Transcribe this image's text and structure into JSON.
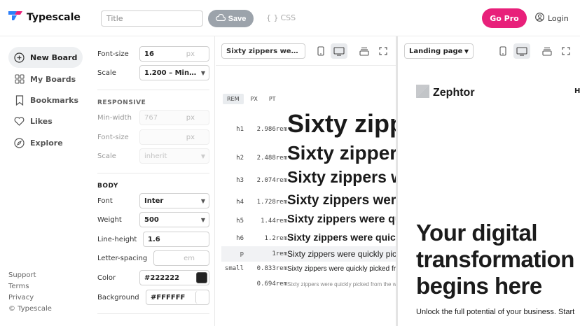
{
  "app": {
    "name": "Typescale"
  },
  "topbar": {
    "title_placeholder": "Title",
    "save_label": "Save",
    "css_label": "CSS",
    "gopro_label": "Go Pro",
    "login_label": "Login"
  },
  "nav": {
    "items": [
      {
        "label": "New Board",
        "icon": "plus-circle-icon",
        "active": true
      },
      {
        "label": "My Boards",
        "icon": "grid-icon"
      },
      {
        "label": "Bookmarks",
        "icon": "bookmark-icon"
      },
      {
        "label": "Likes",
        "icon": "heart-icon"
      },
      {
        "label": "Explore",
        "icon": "compass-icon"
      }
    ],
    "footer": [
      "Support",
      "Terms",
      "Privacy",
      "© Typescale"
    ]
  },
  "settings": {
    "font_size_label": "Font-size",
    "font_size_value": "16",
    "font_size_unit": "px",
    "scale_label": "Scale",
    "scale_value": "1.200 – Min…",
    "responsive_heading": "RESPONSIVE",
    "min_width_label": "Min-width",
    "min_width_value": "767",
    "min_width_unit": "px",
    "resp_font_size_label": "Font-size",
    "resp_font_size_unit": "px",
    "resp_scale_label": "Scale",
    "resp_scale_value": "inherit",
    "body_heading": "BODY",
    "font_label": "Font",
    "font_value": "Inter",
    "weight_label": "Weight",
    "weight_value": "500",
    "line_height_label": "Line-height",
    "line_height_value": "1.6",
    "letter_spacing_label": "Letter-spacing",
    "letter_spacing_unit": "em",
    "color_label": "Color",
    "color_value": "#222222",
    "background_label": "Background",
    "background_value": "#FFFFFF"
  },
  "preview": {
    "sample_select": "Sixty zippers were quickly picked from the woven jute bag",
    "unit_tabs": [
      "REM",
      "PX",
      "PT"
    ],
    "active_unit": "REM",
    "rows": [
      {
        "tag": "h1",
        "rem": "2.986rem",
        "sample": "Sixty zippers were quickly picked from the woven jute bag"
      },
      {
        "tag": "h2",
        "rem": "2.488rem",
        "sample": "Sixty zippers were quickly picked from the woven jute bag"
      },
      {
        "tag": "h3",
        "rem": "2.074rem",
        "sample": "Sixty zippers were quickly picked from the woven jute bag"
      },
      {
        "tag": "h4",
        "rem": "1.728rem",
        "sample": "Sixty zippers were quickly picked from the woven jute bag"
      },
      {
        "tag": "h5",
        "rem": "1.44rem",
        "sample": "Sixty zippers were quickly picked from the woven jute bag"
      },
      {
        "tag": "h6",
        "rem": "1.2rem",
        "sample": "Sixty zippers were quickly picked from the woven jute bag"
      },
      {
        "tag": "p",
        "rem": "1rem",
        "sample": "Sixty zippers were quickly picked from the woven jute bag"
      },
      {
        "tag": "small",
        "rem": "0.833rem",
        "sample": "Sixty zippers were quickly picked from the woven jute bag"
      },
      {
        "tag": "",
        "rem": "0.694rem",
        "sample": "Sixty zippers were quickly picked from the woven jute bag"
      }
    ]
  },
  "landing": {
    "template_select": "Landing page",
    "brand": "Zephtor",
    "nav_peek": "H",
    "hero_lines": [
      "Your digital",
      "transformation",
      "begins here"
    ],
    "hero_sub": "Unlock the full potential of your business. Start"
  },
  "colors": {
    "accent": "#e8207a",
    "save_bg": "#9ca3ab",
    "body_text": "#222222",
    "logo_blue": "#2d7ff9",
    "logo_pink": "#e8207a"
  }
}
